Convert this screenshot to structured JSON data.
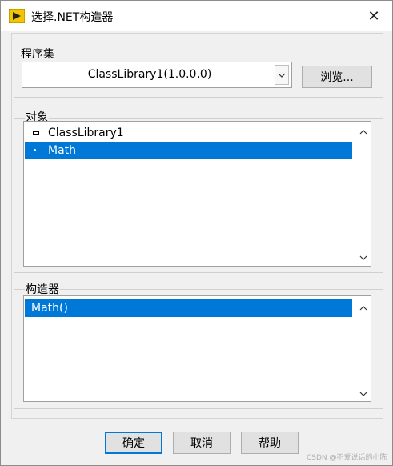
{
  "window": {
    "title": "选择.NET构造器",
    "close_glyph": "✕"
  },
  "assembly": {
    "label": "程序集",
    "selected": "ClassLibrary1(1.0.0.0)",
    "browse_label": "浏览..."
  },
  "objects": {
    "label": "对象",
    "items": [
      {
        "label": "ClassLibrary1",
        "selected": false,
        "icon": "namespace-icon"
      },
      {
        "label": "Math",
        "selected": true,
        "icon": "class-dot-icon"
      }
    ]
  },
  "constructors": {
    "label": "构造器",
    "items": [
      {
        "label": "Math()",
        "selected": true
      }
    ]
  },
  "footer": {
    "ok_label": "确定",
    "cancel_label": "取消",
    "help_label": "帮助"
  },
  "watermark": "CSDN @不爱说话的小陈",
  "colors": {
    "selection": "#0078d7",
    "dialog_bg": "#f0f0f0",
    "default_border": "#0078d7"
  }
}
